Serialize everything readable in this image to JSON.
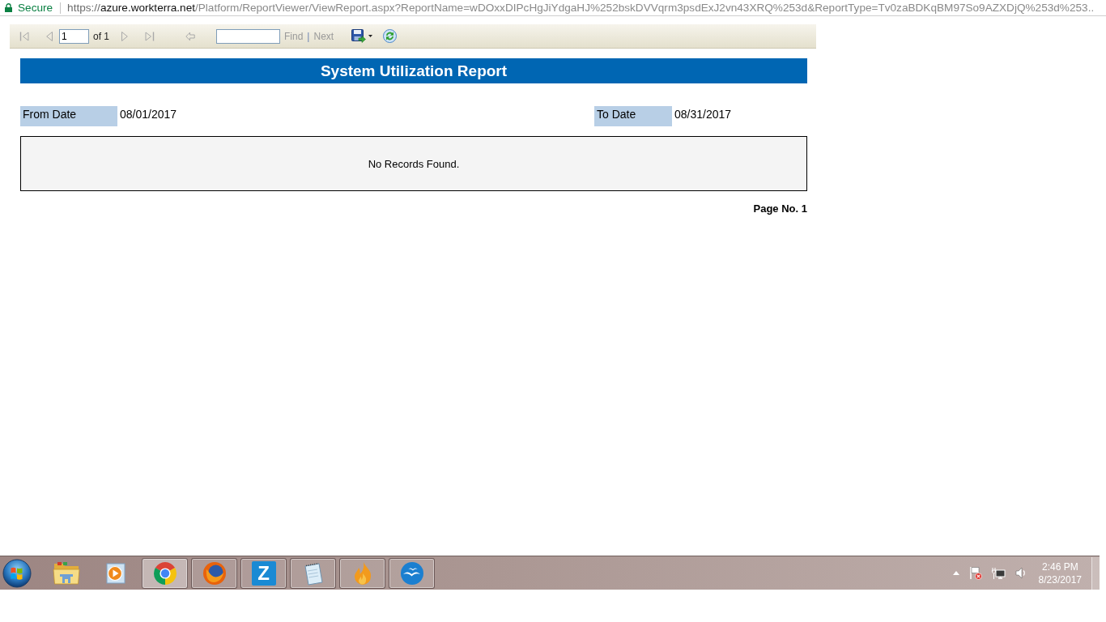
{
  "address_bar": {
    "secure_label": "Secure",
    "url_scheme": "https://",
    "url_host": "azure.workterra.net",
    "url_path": "/Platform/ReportViewer/ViewReport.aspx?ReportName=wDOxxDIPcHgJiYdgaHJ%252bskDVVqrm3psdExJ2vn43XRQ%253d&ReportType=Tv0zaBDKqBM97So9AZXDjQ%253d%253.."
  },
  "toolbar": {
    "first_page": {
      "disabled": true
    },
    "previous_page": {
      "disabled": true
    },
    "page_field": {
      "value": "1"
    },
    "page_count": "of 1",
    "next_page": {
      "disabled": true
    },
    "last_page": {
      "disabled": true
    },
    "back": {
      "disabled": true
    },
    "find_field": {
      "disabled": false
    },
    "find_link": {
      "label": "Find",
      "disabled": true
    },
    "find_separator": "|",
    "next_link": {
      "label": "Next",
      "disabled": true
    },
    "export": {
      "disabled": false
    },
    "refresh": {
      "disabled": false
    }
  },
  "report": {
    "title": "System Utilization Report",
    "parameters": [
      {
        "label": "From Date",
        "value": "08/01/2017"
      },
      {
        "label": "To Date",
        "value": "08/31/2017"
      }
    ],
    "message": "No Records Found.",
    "footer": "Page No. 1"
  },
  "taskbar": {
    "items": [
      {
        "kind": "folder",
        "running": false,
        "selected": false
      },
      {
        "kind": "player",
        "running": false,
        "selected": false
      },
      {
        "kind": "ring",
        "running": true,
        "selected": true
      },
      {
        "kind": "globe",
        "running": true,
        "selected": false
      },
      {
        "kind": "tile",
        "label": "Z",
        "running": true,
        "selected": false
      },
      {
        "kind": "notepad",
        "running": true,
        "selected": false
      },
      {
        "kind": "flame",
        "running": true,
        "selected": false
      },
      {
        "kind": "gull",
        "running": true,
        "selected": false
      }
    ],
    "clock": {
      "time": "2:46 PM",
      "date": "8/23/2017"
    }
  }
}
